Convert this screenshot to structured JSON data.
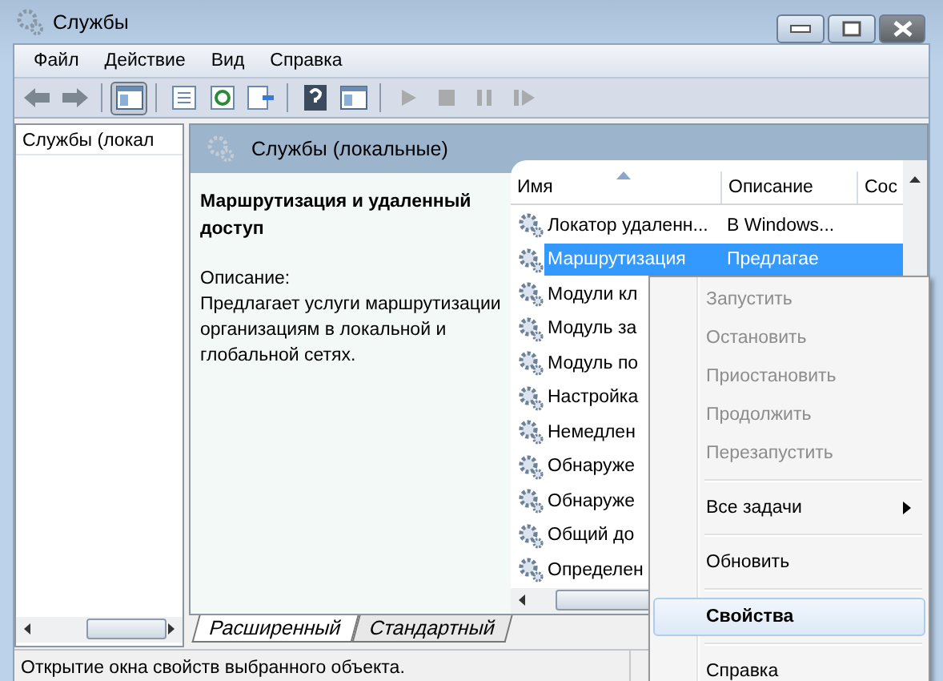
{
  "window": {
    "title": "Службы"
  },
  "menu": [
    "Файл",
    "Действие",
    "Вид",
    "Справка"
  ],
  "toolbar": [
    [
      {
        "kind": "back",
        "disabled": false,
        "selected": false
      },
      {
        "kind": "forward",
        "disabled": false,
        "selected": false
      }
    ],
    [
      {
        "kind": "tree",
        "disabled": false,
        "selected": true
      }
    ],
    [
      {
        "kind": "list",
        "disabled": false,
        "selected": false
      },
      {
        "kind": "refresh",
        "disabled": false,
        "selected": false
      },
      {
        "kind": "export",
        "disabled": false,
        "selected": false
      }
    ],
    [
      {
        "kind": "help",
        "disabled": false,
        "selected": false
      },
      {
        "kind": "panel",
        "disabled": false,
        "selected": false
      }
    ],
    [
      {
        "kind": "play",
        "disabled": true,
        "selected": false
      },
      {
        "kind": "stop",
        "disabled": true,
        "selected": false
      },
      {
        "kind": "pause",
        "disabled": true,
        "selected": false
      },
      {
        "kind": "resume",
        "disabled": true,
        "selected": false
      }
    ]
  ],
  "tree": [
    {
      "label": "Службы (локал",
      "selected": false
    }
  ],
  "pane_header": "Службы (локальные)",
  "description": {
    "title": "Маршрутизация и удаленный доступ",
    "label": "Описание:",
    "text": "Предлагает услуги маршрутизации организациям в локальной и глобальной сетях."
  },
  "table": {
    "columns": [
      {
        "label": "Имя",
        "sorted": true
      },
      {
        "label": "Описание",
        "sorted": false
      },
      {
        "label": "Сос",
        "sorted": false
      }
    ],
    "rows": [
      {
        "name": "Локатор удаленн...",
        "description": "В Windows...",
        "selected": false
      },
      {
        "name": "Маршрутизация",
        "description": "Предлагае",
        "selected": true
      },
      {
        "name": "Модули кл",
        "description": "",
        "selected": false
      },
      {
        "name": "Модуль за",
        "description": "",
        "selected": false
      },
      {
        "name": "Модуль по",
        "description": "",
        "selected": false
      },
      {
        "name": "Настройка",
        "description": "",
        "selected": false
      },
      {
        "name": "Немедлен",
        "description": "",
        "selected": false
      },
      {
        "name": "Обнаруже",
        "description": "",
        "selected": false
      },
      {
        "name": "Обнаруже",
        "description": "",
        "selected": false
      },
      {
        "name": "Общий до",
        "description": "",
        "selected": false
      },
      {
        "name": "Определен",
        "description": "",
        "selected": false
      }
    ]
  },
  "tabs": [
    {
      "label": "Расширенный",
      "selected": true
    },
    {
      "label": "Стандартный",
      "selected": false
    }
  ],
  "status_bar": "Открытие окна свойств выбранного объекта.",
  "context_menu": [
    {
      "kind": "item",
      "label": "Запустить",
      "disabled": true,
      "selected": false,
      "default": false
    },
    {
      "kind": "item",
      "label": "Остановить",
      "disabled": true,
      "selected": false,
      "default": false
    },
    {
      "kind": "item",
      "label": "Приостановить",
      "disabled": true,
      "selected": false,
      "default": false
    },
    {
      "kind": "item",
      "label": "Продолжить",
      "disabled": true,
      "selected": false,
      "default": false
    },
    {
      "kind": "item",
      "label": "Перезапустить",
      "disabled": true,
      "selected": false,
      "default": false
    },
    {
      "kind": "separator"
    },
    {
      "kind": "submenu",
      "label": "Все задачи",
      "disabled": false,
      "selected": false,
      "default": false
    },
    {
      "kind": "separator"
    },
    {
      "kind": "item",
      "label": "Обновить",
      "disabled": false,
      "selected": false,
      "default": false
    },
    {
      "kind": "separator"
    },
    {
      "kind": "item",
      "label": "Свойства",
      "disabled": false,
      "selected": true,
      "default": true
    },
    {
      "kind": "separator"
    },
    {
      "kind": "item",
      "label": "Справка",
      "disabled": false,
      "selected": false,
      "default": false
    }
  ]
}
